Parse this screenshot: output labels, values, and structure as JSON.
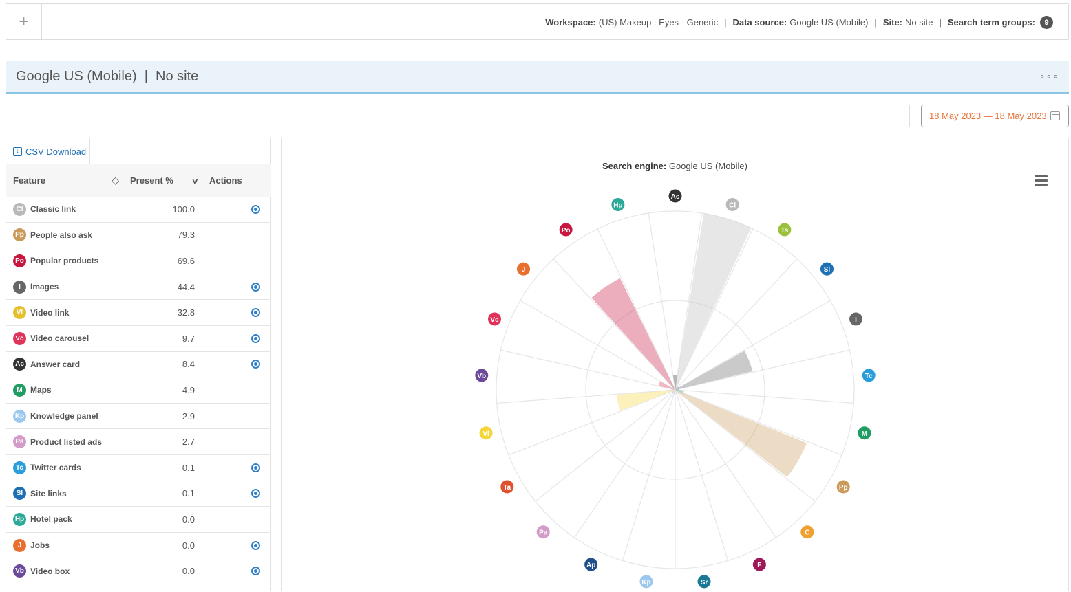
{
  "topbar": {
    "add_label": "+",
    "workspace_label": "Workspace:",
    "workspace": "(US) Makeup : Eyes - Generic",
    "datasource_label": "Data source:",
    "datasource": "Google US (Mobile)",
    "site_label": "Site:",
    "site": "No site",
    "groups_label": "Search term groups:",
    "groups_count": "9",
    "separator": "|"
  },
  "header": {
    "title": "Google US (Mobile)  |  No site",
    "more": "∘∘∘"
  },
  "date_range": "18 May 2023 — 18 May 2023",
  "table": {
    "csv_label": "CSV Download",
    "columns": [
      "Feature",
      "Present %",
      "Actions"
    ],
    "rows": [
      {
        "abbr": "Cl",
        "name": "Classic link",
        "value": "100.0",
        "color": "#b9b9b9",
        "action": true
      },
      {
        "abbr": "Pp",
        "name": "People also ask",
        "value": "79.3",
        "color": "#c99a5a",
        "action": false
      },
      {
        "abbr": "Po",
        "name": "Popular products",
        "value": "69.6",
        "color": "#c8173e",
        "action": false
      },
      {
        "abbr": "I",
        "name": "Images",
        "value": "44.4",
        "color": "#666666",
        "action": true
      },
      {
        "abbr": "Vl",
        "name": "Video link",
        "value": "32.8",
        "color": "#e4c02f",
        "action": true
      },
      {
        "abbr": "Vc",
        "name": "Video carousel",
        "value": "9.7",
        "color": "#e0335a",
        "action": true
      },
      {
        "abbr": "Ac",
        "name": "Answer card",
        "value": "8.4",
        "color": "#333333",
        "action": true
      },
      {
        "abbr": "M",
        "name": "Maps",
        "value": "4.9",
        "color": "#1f9d62",
        "action": false
      },
      {
        "abbr": "Kp",
        "name": "Knowledge panel",
        "value": "2.9",
        "color": "#9cc8ee",
        "action": false
      },
      {
        "abbr": "Pa",
        "name": "Product listed ads",
        "value": "2.7",
        "color": "#d39cc8",
        "action": false
      },
      {
        "abbr": "Tc",
        "name": "Twitter cards",
        "value": "0.1",
        "color": "#2a9ddc",
        "action": true
      },
      {
        "abbr": "Sl",
        "name": "Site links",
        "value": "0.1",
        "color": "#1f6fb5",
        "action": true
      },
      {
        "abbr": "Hp",
        "name": "Hotel pack",
        "value": "0.0",
        "color": "#2aa898",
        "action": false
      },
      {
        "abbr": "J",
        "name": "Jobs",
        "value": "0.0",
        "color": "#e86f2f",
        "action": true
      },
      {
        "abbr": "Vb",
        "name": "Video box",
        "value": "0.0",
        "color": "#6b4a9a",
        "action": true
      }
    ]
  },
  "chart": {
    "title_label": "Search engine:",
    "title_value": "Google US (Mobile)"
  },
  "chart_data": {
    "type": "polar-bar",
    "title": "Search engine: Google US (Mobile)",
    "rmax": 100,
    "grid": true,
    "categories": [
      "Ac",
      "Cl",
      "Ts",
      "Sl",
      "I",
      "Tc",
      "M",
      "Pp",
      "C",
      "F",
      "Sr",
      "Kp",
      "Ap",
      "Pa",
      "Ta",
      "Vl",
      "Vb",
      "Vc",
      "J",
      "Po",
      "Hp"
    ],
    "values": [
      8.4,
      100,
      0,
      0.1,
      44.4,
      0.1,
      4.9,
      79.3,
      0,
      0,
      0,
      2.9,
      0,
      2.7,
      0,
      32.8,
      0,
      9.7,
      0,
      69.6,
      0
    ],
    "colors": [
      "#333333",
      "#b9b9b9",
      "#9bc13c",
      "#1f6fb5",
      "#666666",
      "#2a9ddc",
      "#1f9d62",
      "#c99a5a",
      "#f0a030",
      "#a0185a",
      "#1a7a96",
      "#9cc8ee",
      "#1f4f8a",
      "#d39cc8",
      "#e0502e",
      "#f5d63a",
      "#6b4a9a",
      "#e0335a",
      "#e86f2f",
      "#c8173e",
      "#2aa898"
    ]
  }
}
